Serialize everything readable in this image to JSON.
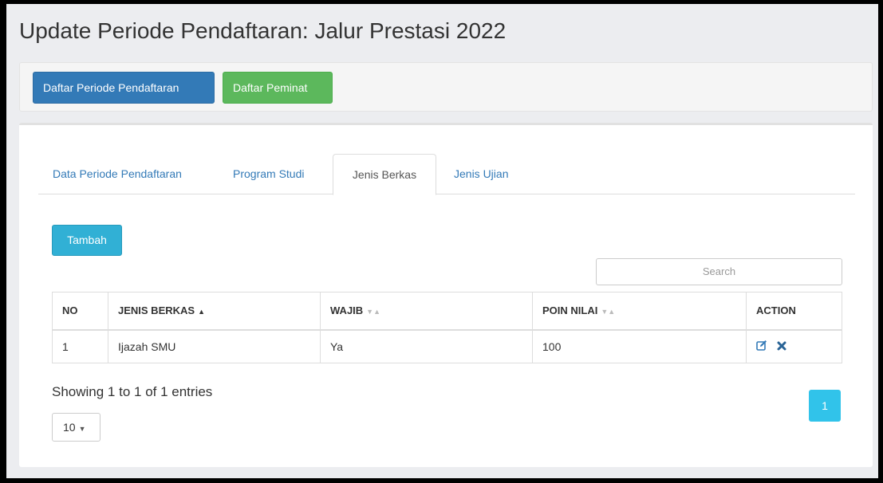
{
  "page": {
    "title": "Update Periode Pendaftaran: Jalur Prestasi 2022"
  },
  "toolbar": {
    "periode_label": "Daftar Periode Pendaftaran",
    "peminat_label": "Daftar Peminat"
  },
  "tabs": [
    {
      "label": "Data Periode Pendaftaran"
    },
    {
      "label": "Program Studi"
    },
    {
      "label": "Jenis Berkas",
      "active": true
    },
    {
      "label": "Jenis Ujian"
    }
  ],
  "actions": {
    "tambah_label": "Tambah"
  },
  "search": {
    "placeholder": "Search"
  },
  "table": {
    "columns": [
      "NO",
      "JENIS BERKAS",
      "WAJIB",
      "POIN NILAI",
      "ACTION"
    ],
    "rows": [
      {
        "no": "1",
        "jenis_berkas": "Ijazah SMU",
        "wajib": "Ya",
        "poin_nilai": "100"
      }
    ]
  },
  "footer": {
    "info": "Showing 1 to 1 of 1 entries",
    "page_size": "10",
    "current_page": "1"
  },
  "colors": {
    "primary": "#337ab7",
    "success": "#5cb85c",
    "info": "#31b0d5",
    "pager": "#31c3ea"
  },
  "icons": {
    "edit": "edit-icon",
    "delete": "delete-icon"
  }
}
